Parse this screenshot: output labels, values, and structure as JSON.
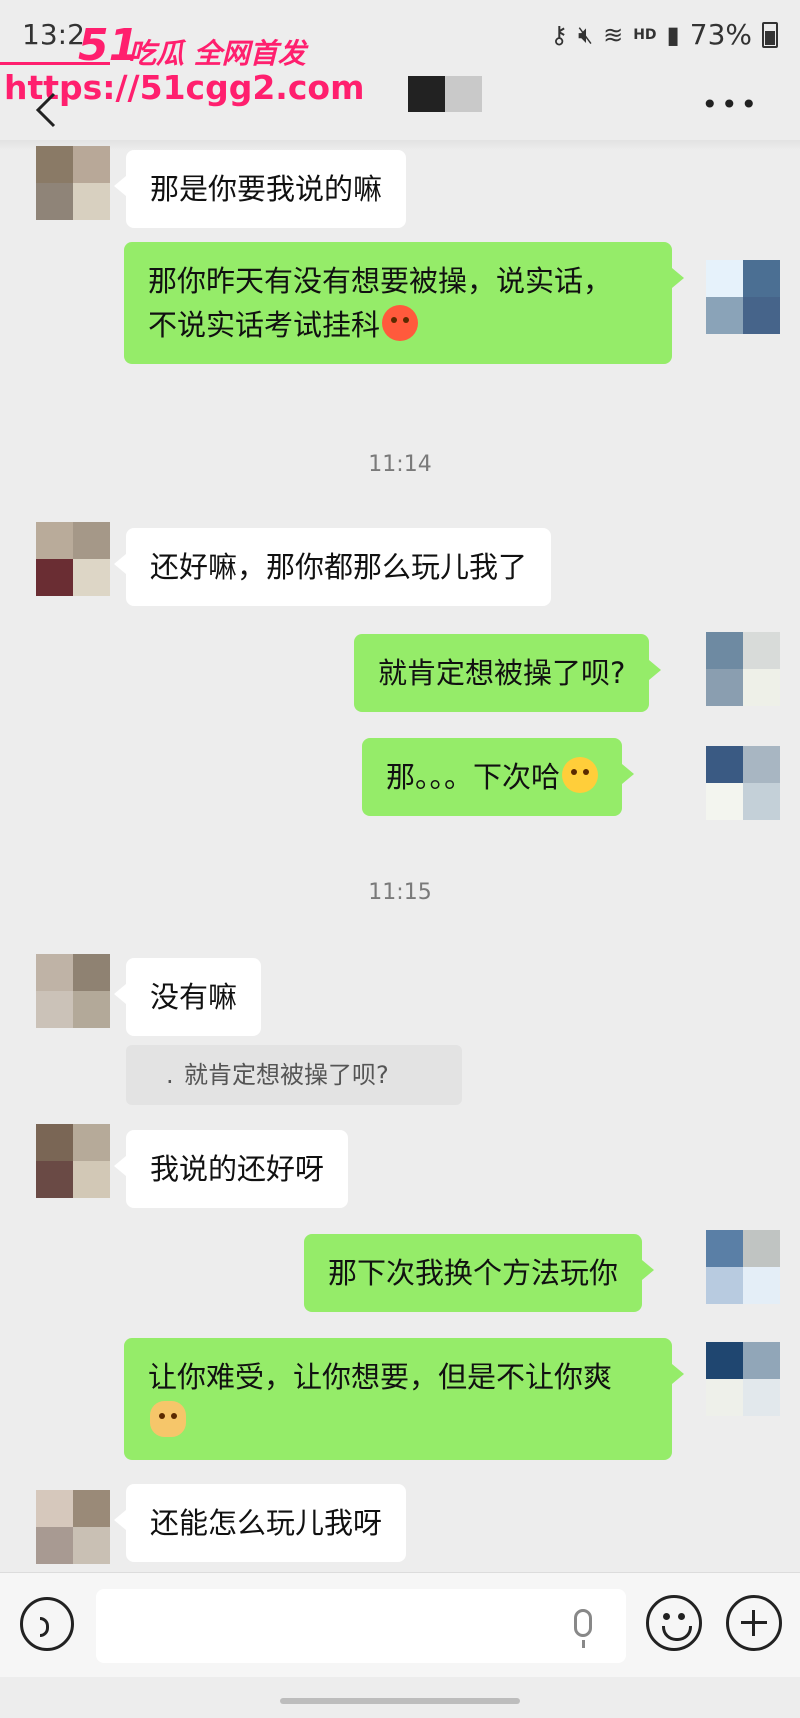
{
  "status_bar": {
    "time": "13:2",
    "battery": "73%",
    "hd": "HD"
  },
  "watermark": {
    "logo": "51",
    "slogan": "吃瓜 全网首发",
    "url": "https://51cgg2.com"
  },
  "timestamps": [
    "11:14",
    "11:15"
  ],
  "messages": [
    {
      "from": "other",
      "text": "那是你要我说的嘛",
      "avatar": [
        "#8a7a66",
        "#b8a898",
        "#8f8478",
        "#d8d0c0",
        "#b49a98",
        "#c8bcae"
      ]
    },
    {
      "from": "me",
      "text": "那你昨天有没有想要被操，说实话，",
      "text2": "不说实话考试挂科",
      "emoji": "angry-face-emoji",
      "avatar": [
        "#e6f2fb",
        "#4b6f93",
        "#8aa3b8",
        "#46648a"
      ]
    },
    {
      "from": "other",
      "text": "还好嘛，那你都那么玩儿我了",
      "avatar": [
        "#b9ab9a",
        "#a59888",
        "#6a2d33",
        "#ddd6c6"
      ]
    },
    {
      "from": "me",
      "text": "就肯定想被操了呗?",
      "avatar": [
        "#6e8aa2",
        "#d8dbd9",
        "#8a9eb0",
        "#eef0e8"
      ]
    },
    {
      "from": "me",
      "text": "那。。。下次哈",
      "emoji": "grin-face-emoji",
      "avatar": [
        "#3a5a83",
        "#a8b6c2",
        "#f3f5ef",
        "#c4d0d8"
      ]
    },
    {
      "from": "other",
      "text": "没有嘛",
      "avatar": [
        "#bfb3a6",
        "#8f8272",
        "#cbc2b8",
        "#b3a999"
      ]
    },
    {
      "from": "other",
      "text": "我说的还好呀",
      "avatar": [
        "#7a6655",
        "#b6aa99",
        "#6a4a45",
        "#d2c8b6"
      ]
    },
    {
      "from": "me",
      "text": "那下次我换个方法玩你",
      "avatar": [
        "#5a7fa6",
        "#c0c4c2",
        "#b8cbe0",
        "#e4eef7"
      ]
    },
    {
      "from": "me",
      "text": "让你难受，让你想要，但是不让你爽",
      "emoji": "doge-emoji",
      "avatar": [
        "#1f4670",
        "#91a6b8",
        "#eef0ea",
        "#e2e8ec"
      ]
    },
    {
      "from": "other",
      "text": "还能怎么玩儿我呀",
      "avatar": [
        "#d6c8bc",
        "#9a8a78",
        "#a89a92",
        "#c9c0b4"
      ]
    }
  ],
  "quote": {
    "dot": ".",
    "text": "就肯定想被操了呗?"
  },
  "contact": {
    "blocks": [
      "#222222",
      "#c9c9c9"
    ]
  },
  "colors": {
    "outgoing_bubble": "#95ec69",
    "incoming_bubble": "#ffffff",
    "background": "#ededed",
    "watermark": "#ff1f6e"
  }
}
